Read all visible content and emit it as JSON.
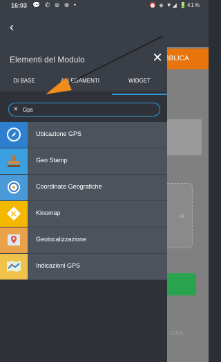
{
  "status_bar": {
    "time": "16:03",
    "notifications": "💬 ✆ ⊛ ⊗ •",
    "right": "⏰ ◈ ▼◢ 🔋41%"
  },
  "topbar": {
    "back_icon": "arrow-left"
  },
  "background": {
    "orange_button": "BBLICA",
    "dashed_hint": "al.",
    "bottom_text": "GINA ..."
  },
  "panel": {
    "title": "Elementi del Modulo",
    "close_icon": "close-icon",
    "tabs": [
      {
        "label": "DI BASE",
        "active": false
      },
      {
        "label": "ALLEGAMENTI",
        "active": false
      },
      {
        "label": "WIDGET",
        "active": true
      }
    ],
    "search": {
      "value": "Gps",
      "placeholder": ""
    },
    "items": [
      {
        "label": "Ubicazione GPS",
        "icon": "compass-icon",
        "color": "#2f7fd1"
      },
      {
        "label": "Geo Stamp",
        "icon": "stamp-icon",
        "color": "#3aa0e0"
      },
      {
        "label": "Coordinate Geografiche",
        "icon": "target-icon",
        "color": "#4a9ad9"
      },
      {
        "label": "Kinomap",
        "icon": "kinomap-icon",
        "color": "#f5b800"
      },
      {
        "label": "Geolocalizzazione",
        "icon": "map-pin-icon",
        "color": "#e9a24a"
      },
      {
        "label": "Indicazioni GPS",
        "icon": "map-icon",
        "color": "#f0c24a"
      }
    ]
  },
  "colors": {
    "accent": "#2f9bd6",
    "orange": "#e8740c",
    "green": "#2aa34f"
  }
}
